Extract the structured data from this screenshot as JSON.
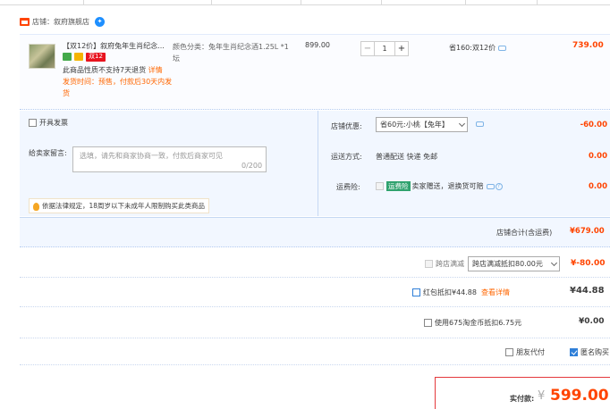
{
  "shop": {
    "name": "店铺：叙府旗舰店"
  },
  "item": {
    "title": "【双12价】叙府兔年生肖纪念...",
    "promo_tag": "双12",
    "no_return": "此商品性质不支持7天退货",
    "detail_link": "详情",
    "ship_time": "发货时间：预售，付款后30天内发货",
    "sku": "颜色分类：兔年生肖纪念酒1.25L *1坛",
    "unit_price": "899.00",
    "quantity": "1",
    "saving": "省160:双12价",
    "subtotal": "739.00"
  },
  "options": {
    "invoice": "开具发票",
    "message_label": "给卖家留言:",
    "message_placeholder": "选填，请先和商家协商一致，付款后商家可见",
    "message_count": "0/200",
    "law_notice": "依据法律规定，18周岁以下未成年人限制购买此类商品",
    "shop_discount_label": "店铺优惠:",
    "shop_discount_select": "省60元:小桃【兔年】",
    "shop_discount_value": "-60.00",
    "shipping_label": "运送方式:",
    "shipping_value": "普通配送 快递 免邮",
    "shipping_amount": "0.00",
    "insurance_label": "运费险:",
    "insurance_badge": "运费险",
    "insurance_text": "卖家赠送，退换货可赔",
    "insurance_amount": "0.00"
  },
  "shop_total": {
    "label": "店铺合计(含运费)",
    "value": "¥679.00"
  },
  "cross_shop": {
    "label": "跨店满减",
    "select": "跨店满减抵扣80.00元",
    "value": "¥-80.00"
  },
  "red_packet": {
    "label": "红包抵扣¥44.88",
    "link": "查看详情",
    "value": "¥44.88"
  },
  "coins": {
    "label": "使用675淘金币抵扣6.75元",
    "value": "¥0.00"
  },
  "friend_pay": "朋友代付",
  "anonymous": "匿名购买",
  "payment": {
    "label": "实付款:",
    "currency": "¥",
    "value": "599.00"
  },
  "colors": {
    "accent": "#ff4400",
    "panel": "#f2f7ff",
    "link_blue": "#2f7fd8"
  }
}
